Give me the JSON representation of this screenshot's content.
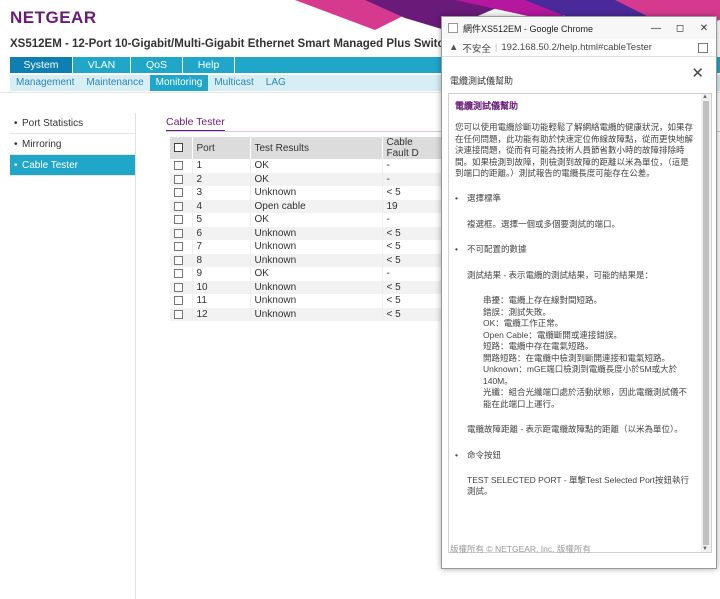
{
  "brand": "NETGEAR",
  "device_title": "XS512EM - 12-Port 10-Gigabit/Multi-Gigabit Ethernet Smart Managed Plus Switch",
  "nav_primary": [
    {
      "label": "System"
    },
    {
      "label": "VLAN"
    },
    {
      "label": "QoS"
    },
    {
      "label": "Help"
    }
  ],
  "nav_secondary": [
    {
      "label": "Management"
    },
    {
      "label": "Maintenance"
    },
    {
      "label": "Monitoring"
    },
    {
      "label": "Multicast"
    },
    {
      "label": "LAG"
    }
  ],
  "sidebar": [
    {
      "label": "Port Statistics"
    },
    {
      "label": "Mirroring"
    },
    {
      "label": "Cable Tester"
    }
  ],
  "section_title": "Cable Tester",
  "table": {
    "headers": [
      "Port",
      "Test Results",
      "Cable Fault D"
    ],
    "rows": [
      {
        "port": "1",
        "result": "OK",
        "fault": "-"
      },
      {
        "port": "2",
        "result": "OK",
        "fault": "-"
      },
      {
        "port": "3",
        "result": "Unknown",
        "fault": "< 5"
      },
      {
        "port": "4",
        "result": "Open cable",
        "fault": "19"
      },
      {
        "port": "5",
        "result": "OK",
        "fault": "-"
      },
      {
        "port": "6",
        "result": "Unknown",
        "fault": "< 5"
      },
      {
        "port": "7",
        "result": "Unknown",
        "fault": "< 5"
      },
      {
        "port": "8",
        "result": "Unknown",
        "fault": "< 5"
      },
      {
        "port": "9",
        "result": "OK",
        "fault": "-"
      },
      {
        "port": "10",
        "result": "Unknown",
        "fault": "< 5"
      },
      {
        "port": "11",
        "result": "Unknown",
        "fault": "< 5"
      },
      {
        "port": "12",
        "result": "Unknown",
        "fault": "< 5"
      }
    ]
  },
  "popup": {
    "window_title": "網件XS512EM - Google Chrome",
    "insecure_label": "不安全",
    "url": "192.168.50.2/help.html#cableTester",
    "help_header": "電纜測試儀幫助",
    "content_title": "電纜測試儀幫助",
    "intro": "您可以使用電纜診斷功能輕鬆了解網絡電纜的健康狀況，如果存在任何問題，此功能有助於快速定位佈線故障點，從而更快地解決連接問題，從而有可能為技術人員節省數小時的故障排除時間。如果檢測到故障，則檢測到故障的距離以米為單位，（這是到端口的距離。）測試報告的電纜長度可能存在公差。",
    "b1": "選擇標準",
    "b1_desc": "複選框。選擇一個或多個要測試的端口。",
    "b2": "不可配置的數據",
    "b2_desc": "測試結果 - 表示電纜的測試結果，可能的結果是：",
    "results": [
      "串擾：電纜上存在線對間短路。",
      "錯誤：測試失敗。",
      "OK：電纜工作正常。",
      "Open Cable：電纜斷開或連接錯誤。",
      "短路：電纜中存在電氣短路。",
      "開路短路：在電纜中檢測到斷開連接和電氣短路。",
      "Unknown：mGE端口檢測到電纜長度小於5M或大於140M。",
      "光纖：組合光纖端口處於活動狀態，因此電纜測試儀不能在此端口上運行。"
    ],
    "fault_distance": "電纜故障距離 - 表示距電纜故障點的距離（以米為單位）。",
    "b3": "命令按鈕",
    "b3_desc": "TEST SELECTED PORT - 單擊Test Selected Port按鈕執行測試。",
    "footer": "版權所有 © NETGEAR, Inc. 版權所有"
  }
}
